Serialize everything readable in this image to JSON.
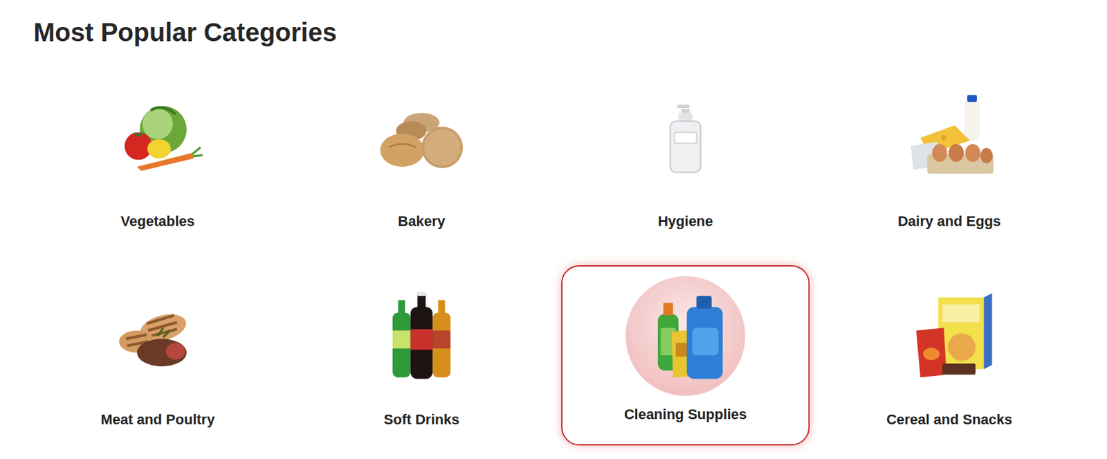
{
  "title": "Most Popular Categories",
  "categories": [
    {
      "label": "Vegetables",
      "selected": false
    },
    {
      "label": "Bakery",
      "selected": false
    },
    {
      "label": "Hygiene",
      "selected": false
    },
    {
      "label": "Dairy and Eggs",
      "selected": false
    },
    {
      "label": "Meat and Poultry",
      "selected": false
    },
    {
      "label": "Soft Drinks",
      "selected": false
    },
    {
      "label": "Cleaning Supplies",
      "selected": true
    },
    {
      "label": "Cereal and Snacks",
      "selected": false
    }
  ]
}
